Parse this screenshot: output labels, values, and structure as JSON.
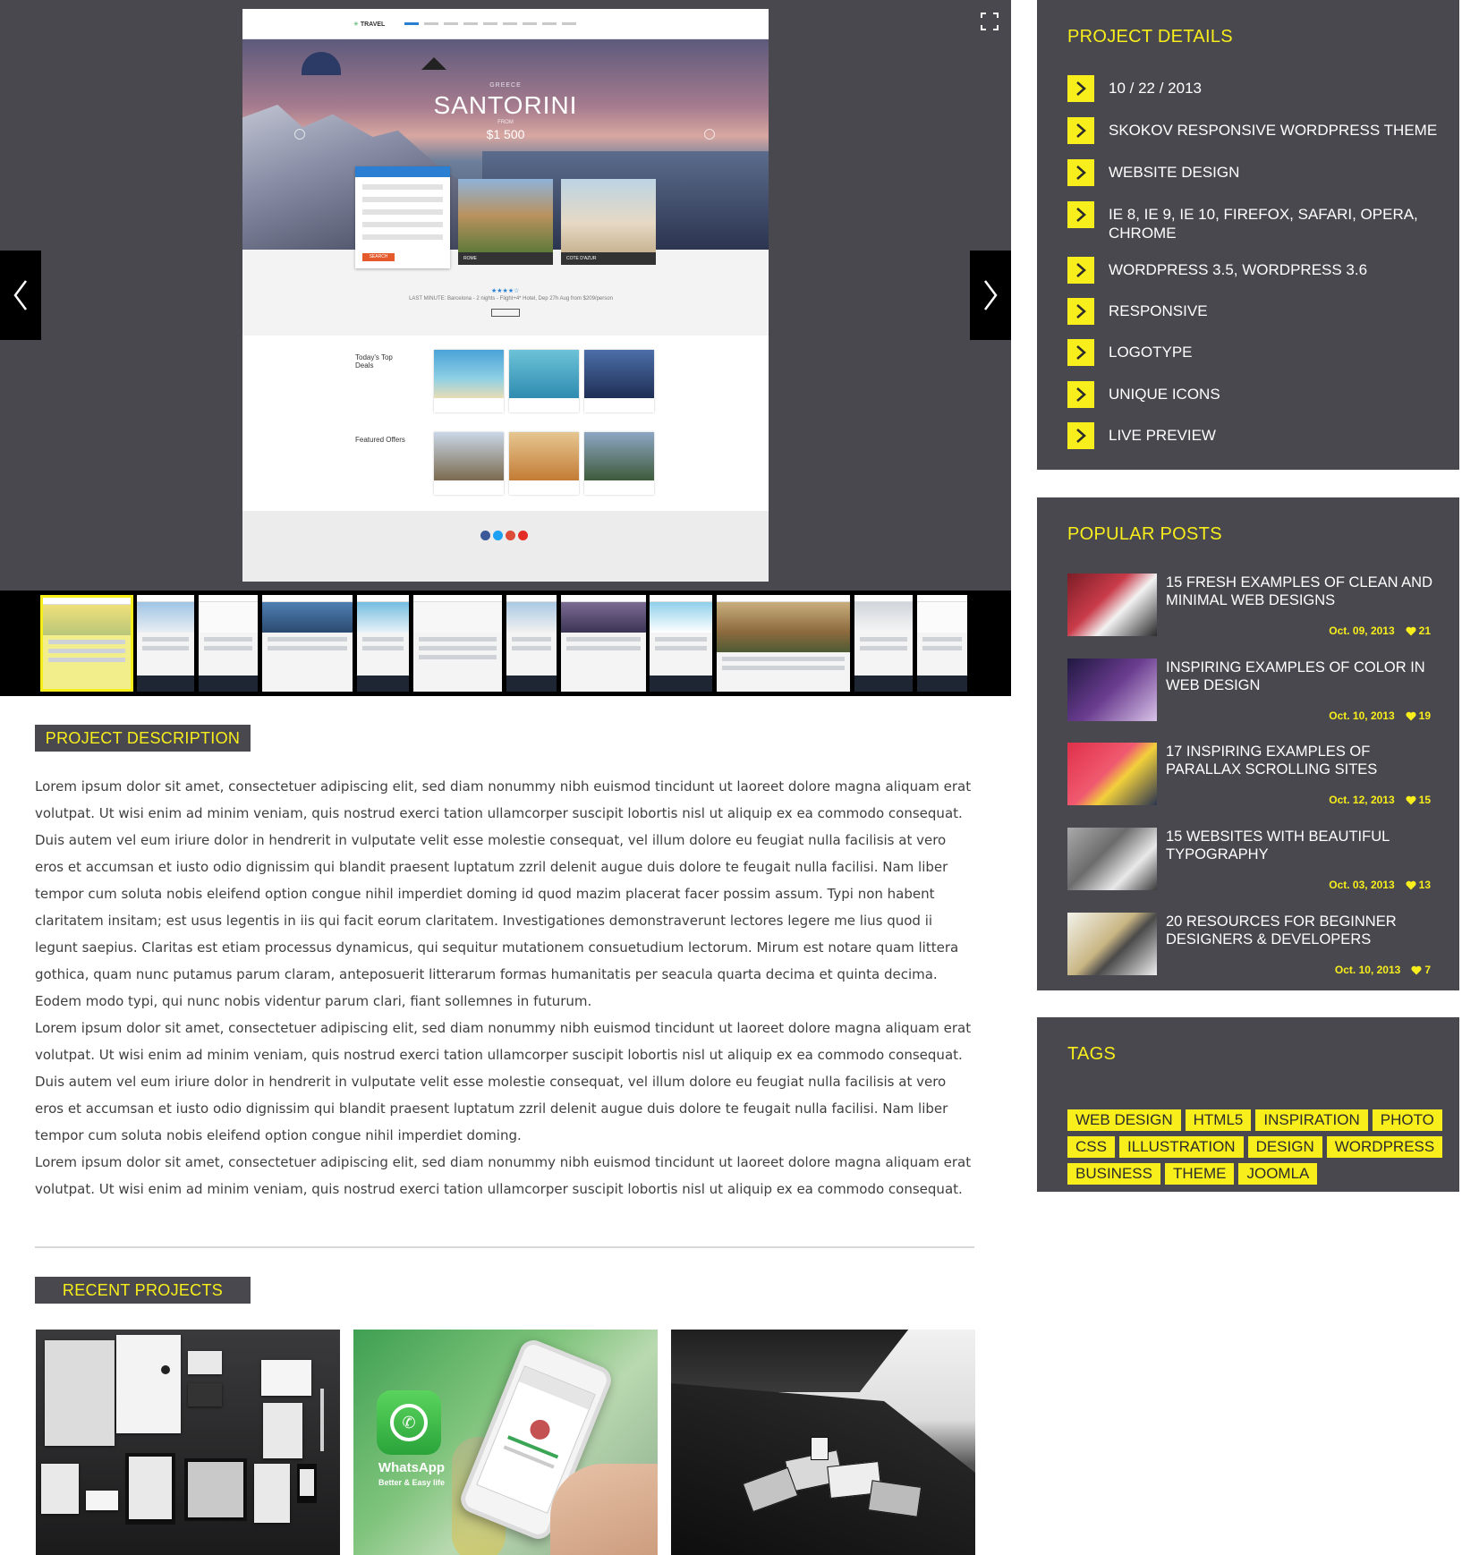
{
  "gallery": {
    "mock": {
      "logo": "TRAVEL",
      "dest_country": "GREECE",
      "dest_name": "SANTORINI",
      "dest_from": "FROM",
      "dest_price": "$1 500",
      "card1": "ROME",
      "card2": "COTE D'AZUR",
      "last_minute": "LAST MINUTE: Barcelona - 2 nights - Flight+4* Hotel, Dep 27h Aug from $209/person",
      "deals_label": "Today's Top Deals",
      "offers_label": "Featured Offers",
      "form_button": "SEARCH"
    }
  },
  "sections": {
    "description_title": "PROJECT DESCRIPTION",
    "recent_title": "RECENT PROJECTS"
  },
  "description": {
    "p1": "Lorem ipsum dolor sit amet, consectetuer adipiscing elit, sed diam nonummy nibh euismod tincidunt ut laoreet dolore magna aliquam erat volutpat. Ut wisi enim ad minim veniam, quis nostrud exerci tation ullamcorper suscipit lobortis nisl ut aliquip ex ea commodo consequat. Duis autem vel eum iriure dolor in hendrerit in vulputate velit esse molestie consequat, vel illum dolore eu feugiat nulla facilisis at vero eros et accumsan et iusto odio dignissim qui blandit praesent luptatum zzril delenit augue duis dolore te feugait nulla facilisi. Nam liber tempor cum soluta nobis eleifend option congue nihil imperdiet doming id quod mazim placerat facer possim assum. Typi non habent claritatem insitam; est usus legentis in iis qui facit eorum claritatem. Investigationes demonstraverunt lectores legere me lius quod ii legunt saepius. Claritas est etiam processus dynamicus, qui sequitur mutationem consuetudium lectorum. Mirum est notare quam littera gothica, quam nunc putamus parum claram, anteposuerit litterarum formas humanitatis per seacula quarta decima et quinta decima. Eodem modo typi, qui nunc nobis videntur parum clari, fiant sollemnes in futurum.",
    "p2": "Lorem ipsum dolor sit amet, consectetuer adipiscing elit, sed diam nonummy nibh euismod tincidunt ut laoreet dolore magna aliquam erat volutpat. Ut wisi enim ad minim veniam, quis nostrud exerci tation ullamcorper suscipit lobortis nisl ut aliquip ex ea commodo consequat. Duis autem vel eum iriure dolor in hendrerit in vulputate velit esse molestie consequat, vel illum dolore eu feugiat nulla facilisis at vero eros et accumsan et iusto odio dignissim qui blandit praesent luptatum zzril delenit augue duis dolore te feugait nulla facilisi. Nam liber tempor cum soluta nobis eleifend option congue nihil imperdiet doming.",
    "p3": "Lorem ipsum dolor sit amet, consectetuer adipiscing elit, sed diam nonummy nibh euismod tincidunt ut laoreet dolore magna aliquam erat volutpat. Ut wisi enim ad minim veniam, quis nostrud exerci tation ullamcorper suscipit lobortis nisl ut aliquip ex ea commodo consequat."
  },
  "recent": {
    "whatsapp_name": "WhatsApp",
    "whatsapp_sub": "Better & Easy life"
  },
  "sidebar": {
    "details_title": "PROJECT DETAILS",
    "details": [
      "10 / 22 / 2013",
      "SKOKOV RESPONSIVE WORDPRESS THEME",
      "WEBSITE DESIGN",
      "IE 8, IE 9, IE 10, FIREFOX, SAFARI, OPERA, CHROME",
      "WORDPRESS 3.5, WORDPRESS 3.6",
      "RESPONSIVE",
      "LOGOTYPE",
      "UNIQUE ICONS",
      "LIVE PREVIEW"
    ],
    "popular_title": "POPULAR POSTS",
    "posts": [
      {
        "title": "15 FRESH EXAMPLES OF CLEAN AND MINIMAL WEB DESIGNS",
        "date": "Oct. 09, 2013",
        "likes": "21"
      },
      {
        "title": "INSPIRING EXAMPLES OF COLOR IN WEB DESIGN",
        "date": "Oct. 10, 2013",
        "likes": "19"
      },
      {
        "title": "17 INSPIRING EXAMPLES OF PARALLAX SCROLLING SITES",
        "date": "Oct. 12, 2013",
        "likes": "15"
      },
      {
        "title": "15 WEBSITES WITH BEAUTIFUL TYPOGRAPHY",
        "date": "Oct. 03, 2013",
        "likes": "13"
      },
      {
        "title": "20 RESOURCES FOR BEGINNER DESIGNERS & DEVELOPERS",
        "date": "Oct. 10, 2013",
        "likes": "7"
      }
    ],
    "tags_title": "TAGS",
    "tags": [
      "WEB DESIGN",
      "HTML5",
      "INSPIRATION",
      "PHOTO",
      "CSS",
      "ILLUSTRATION",
      "DESIGN",
      "WORDPRESS",
      "BUSINESS",
      "THEME",
      "JOOMLA"
    ]
  },
  "colors": {
    "accent": "#f8ee1c",
    "panel": "#48484e",
    "thumbbar": "#000000"
  }
}
